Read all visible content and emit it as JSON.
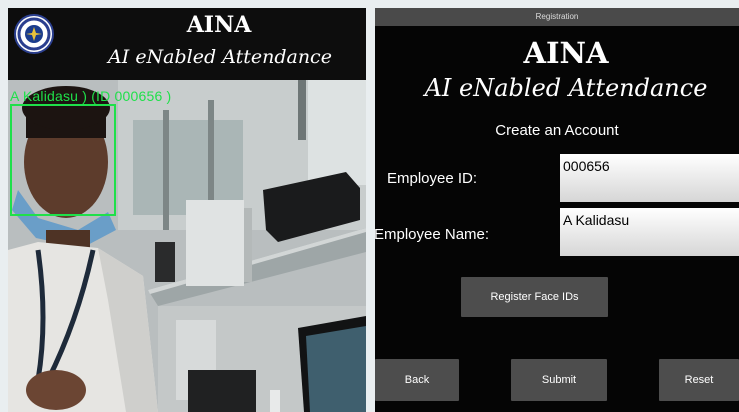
{
  "camera_window": {
    "brand_title": "AINA",
    "brand_subtitle": "AI eNabled Attendance",
    "detection_label": "A Kalidasu ) (ID 000656 )"
  },
  "registration_window": {
    "window_title": "Registration",
    "brand_title": "AINA",
    "brand_subtitle": "AI eNabled Attendance",
    "heading": "Create an Account",
    "employee_id_label": "Employee ID:",
    "employee_id_value": "000656",
    "employee_name_label": "Employee Name:",
    "employee_name_value": "A Kalidasu",
    "register_button": "Register Face IDs",
    "back_button": "Back",
    "submit_button": "Submit",
    "reset_button": "Reset"
  },
  "colors": {
    "detection_box": "#1fe04a",
    "panel_background": "#050505",
    "button_background": "#4d4d4d"
  }
}
